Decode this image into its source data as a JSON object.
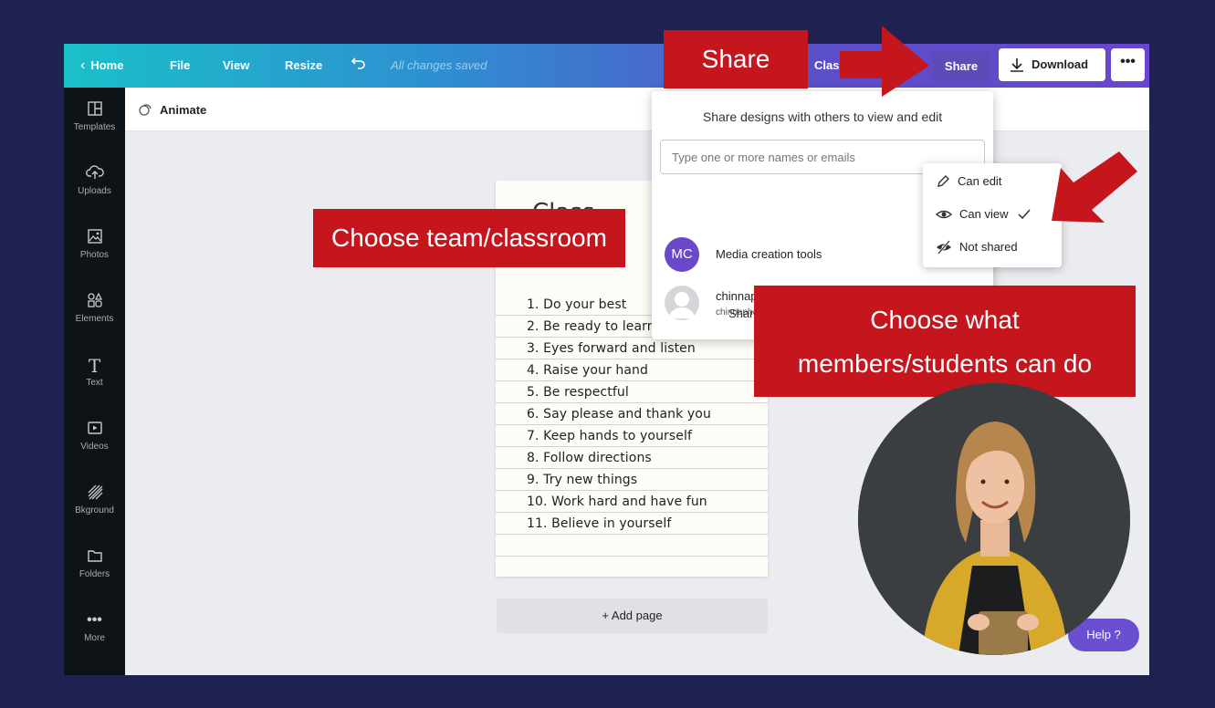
{
  "colors": {
    "background": "#1f2250",
    "callout_red": "#c5161d",
    "accent_purple": "#6b4fd1",
    "sidebar": "#0e1318"
  },
  "topbar": {
    "home": "Home",
    "file": "File",
    "view": "View",
    "resize": "Resize",
    "saved_status": "All changes saved",
    "doc_title": "Class",
    "share": "Share",
    "download": "Download",
    "more": "•••"
  },
  "sidebar": {
    "items": [
      {
        "label": "Templates",
        "icon": "templates-icon"
      },
      {
        "label": "Uploads",
        "icon": "uploads-icon"
      },
      {
        "label": "Photos",
        "icon": "photos-icon"
      },
      {
        "label": "Elements",
        "icon": "elements-icon"
      },
      {
        "label": "Text",
        "icon": "text-icon"
      },
      {
        "label": "Videos",
        "icon": "videos-icon"
      },
      {
        "label": "Bkground",
        "icon": "background-icon"
      },
      {
        "label": "Folders",
        "icon": "folder-icon"
      },
      {
        "label": "More",
        "icon": "more-icon"
      }
    ]
  },
  "subbar": {
    "animate": "Animate"
  },
  "canvas": {
    "title": "Class",
    "rules": [
      "1. Do your best",
      "2. Be ready to learn",
      "3. Eyes forward and listen",
      "4. Raise your hand",
      "5. Be respectful",
      "6. Say please and thank you",
      "7. Keep hands to yourself",
      "8. Follow directions",
      "9. Try new things",
      "10. Work hard and have fun",
      "11. Believe in yourself"
    ],
    "add_page": "+ Add page"
  },
  "share_popup": {
    "heading": "Share designs with others to view and edit",
    "input_placeholder": "Type one or more names or emails",
    "members": [
      {
        "initials": "MC",
        "name": "Media creation tools",
        "email": ""
      },
      {
        "initials": "",
        "name": "chinnaphat.edu",
        "email": "chinnaphat.cha@mahidol.edu"
      }
    ],
    "share_button": "Share"
  },
  "permission_menu": {
    "options": [
      {
        "label": "Can edit",
        "icon": "pencil-icon",
        "selected": false
      },
      {
        "label": "Can view",
        "icon": "eye-icon",
        "selected": true
      },
      {
        "label": "Not shared",
        "icon": "eye-slash-icon",
        "selected": false
      }
    ]
  },
  "help": {
    "label": "Help ?"
  },
  "callouts": {
    "share": "Share",
    "team": "Choose team/classroom",
    "perm_line1": "Choose what",
    "perm_line2": "members/students can do"
  }
}
